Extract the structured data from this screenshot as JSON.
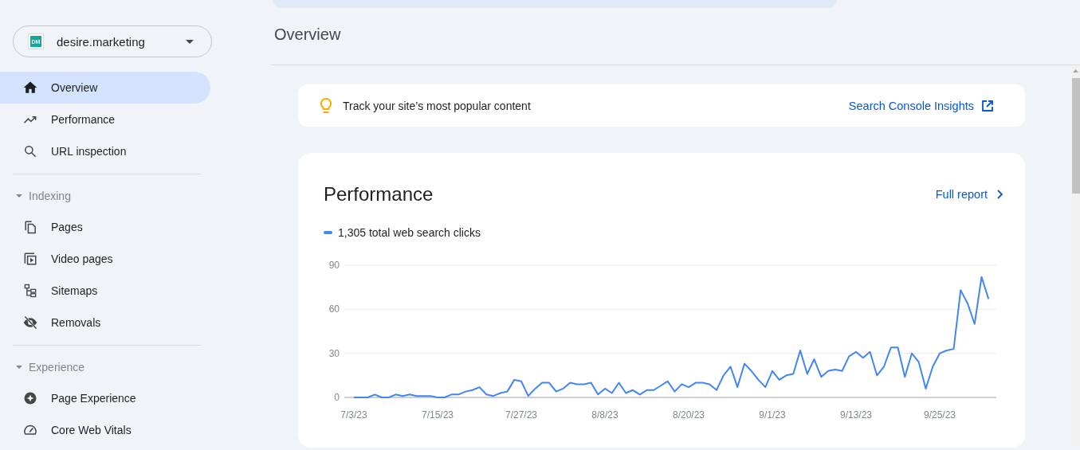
{
  "sidebar": {
    "property": {
      "initials": "DM",
      "name": "desire.marketing"
    },
    "items": [
      {
        "label": "Overview",
        "selected": true
      },
      {
        "label": "Performance",
        "selected": false
      },
      {
        "label": "URL inspection",
        "selected": false
      }
    ],
    "sections": [
      {
        "title": "Indexing",
        "expanded": true,
        "items": [
          {
            "label": "Pages",
            "selected": false
          },
          {
            "label": "Video pages",
            "selected": false
          },
          {
            "label": "Sitemaps",
            "selected": false
          },
          {
            "label": "Removals",
            "selected": false
          }
        ]
      },
      {
        "title": "Experience",
        "expanded": true,
        "items": [
          {
            "label": "Page Experience",
            "selected": false
          },
          {
            "label": "Core Web Vitals",
            "selected": false
          }
        ]
      }
    ]
  },
  "page_title": "Overview",
  "tip": {
    "text": "Track your site’s most popular content",
    "link": "Search Console Insights"
  },
  "performance": {
    "title": "Performance",
    "link": "Full report",
    "chart_data": {
      "type": "line",
      "categories": [
        "7/3/23",
        null,
        null,
        null,
        null,
        null,
        null,
        null,
        null,
        null,
        null,
        null,
        "7/15/23",
        null,
        null,
        null,
        null,
        null,
        null,
        null,
        null,
        null,
        null,
        null,
        "7/27/23",
        null,
        null,
        null,
        null,
        null,
        null,
        null,
        null,
        null,
        null,
        null,
        "8/8/23",
        null,
        null,
        null,
        null,
        null,
        null,
        null,
        null,
        null,
        null,
        null,
        "8/20/23",
        null,
        null,
        null,
        null,
        null,
        null,
        null,
        null,
        null,
        null,
        null,
        "9/1/23",
        null,
        null,
        null,
        null,
        null,
        null,
        null,
        null,
        null,
        null,
        null,
        "9/13/23",
        null,
        null,
        null,
        null,
        null,
        null,
        null,
        null,
        null,
        null,
        null,
        "9/25/23",
        null,
        null,
        null,
        null,
        null,
        null,
        null
      ],
      "series": [
        {
          "name": "1,305 total web search clicks",
          "color": "#4285f4",
          "values": [
            0,
            0,
            0,
            2,
            0,
            0,
            2,
            1,
            2,
            1,
            1,
            1,
            0,
            0,
            2,
            2,
            4,
            5,
            7,
            2,
            1,
            3,
            4,
            12,
            11,
            1,
            6,
            10,
            10,
            4,
            6,
            10,
            9,
            9,
            10,
            2,
            6,
            3,
            10,
            3,
            5,
            2,
            5,
            5,
            8,
            11,
            4,
            9,
            7,
            10,
            10,
            9,
            5,
            15,
            21,
            7,
            23,
            18,
            12,
            7,
            18,
            12,
            15,
            16,
            32,
            16,
            26,
            14,
            18,
            19,
            18,
            28,
            31,
            27,
            31,
            15,
            21,
            34,
            34,
            14,
            30,
            24,
            6,
            21,
            30,
            32,
            33,
            73,
            64,
            50,
            82,
            67
          ]
        }
      ],
      "ylim": [
        0,
        90
      ],
      "yticks": [
        0,
        30,
        60,
        90
      ]
    }
  }
}
